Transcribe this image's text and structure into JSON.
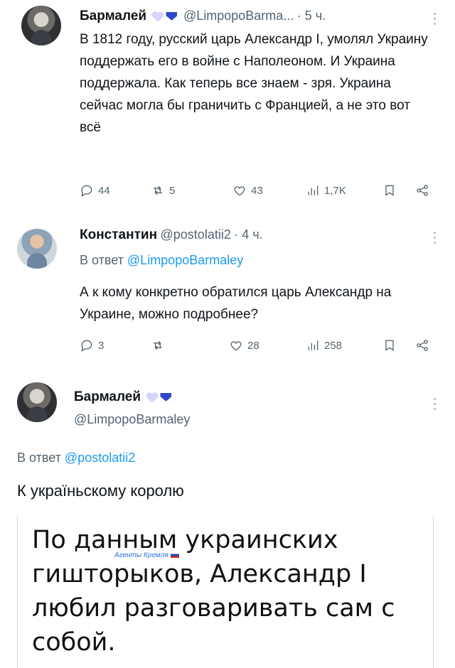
{
  "tweets": [
    {
      "name": "Бармалей",
      "handle": "@LimpopoBarma...",
      "time": "· 5 ч.",
      "text": "В 1812 году, русский царь Александр I, умолял Украину поддержать его в войне с Наполеоном. И Украина поддержала. Как теперь все знаем - зря. Украина сейчас могла бы граничить с Францией, а не это вот всё",
      "counts": {
        "replies": "44",
        "retweets": "5",
        "likes": "43",
        "views": "1,7K"
      }
    },
    {
      "name": "Константин",
      "handle": "@postolatii2",
      "time": "· 4 ч.",
      "reply_prefix": "В ответ",
      "reply_handle": "@LimpopoBarmaley",
      "text": "А к кому конкретно обратился царь Александр на Украине, можно подробнее?",
      "counts": {
        "replies": "3",
        "retweets": "",
        "likes": "28",
        "views": "258"
      }
    },
    {
      "name": "Бармалей",
      "handle": "@LimpopoBarmaley",
      "reply_prefix": "В ответ",
      "reply_handle": "@postolatii2",
      "text": "К україньскому королю"
    }
  ],
  "caption": "По данным украинских гишторыков, Александр I любил разговаривать сам с собой.",
  "watermark": "Агенты Кремля",
  "colors": {
    "link": "#1d9bf0",
    "muted": "#536471",
    "badge": "#2d49c7"
  }
}
